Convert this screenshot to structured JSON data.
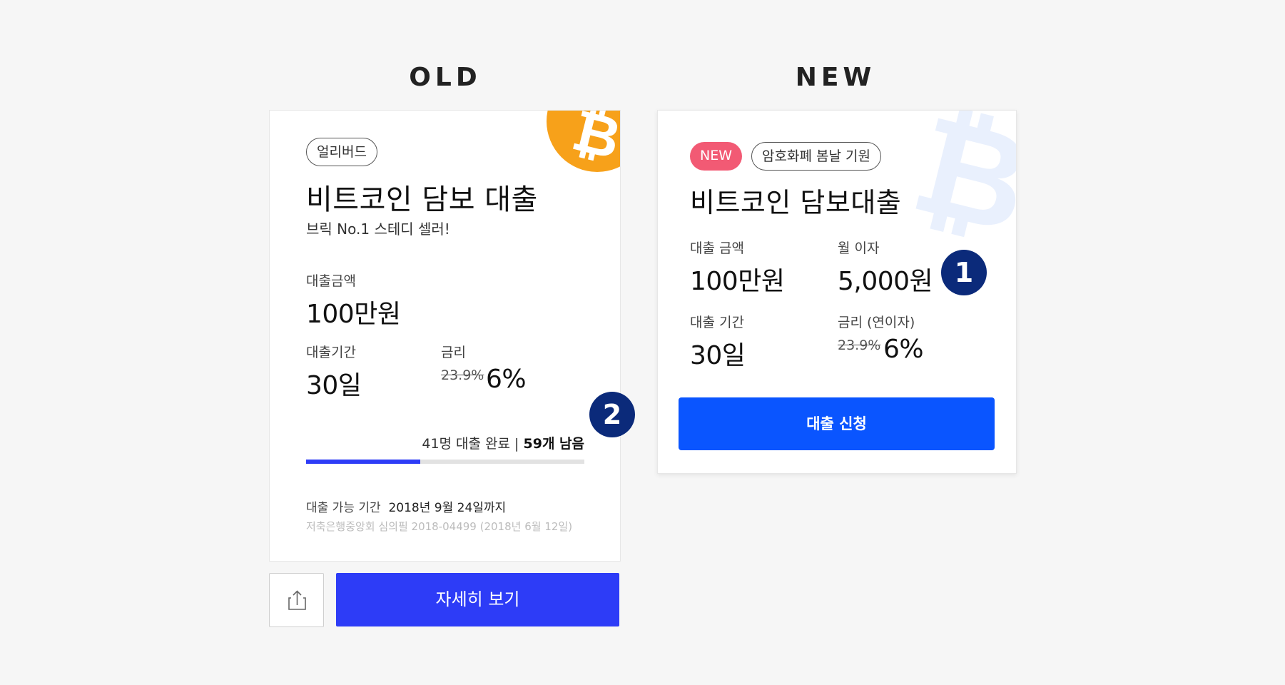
{
  "headings": {
    "old": "OLD",
    "new": "NEW"
  },
  "old_card": {
    "tag": "얼리버드",
    "title": "비트코인 담보 대출",
    "subtitle": "브릭 No.1 스테디 셀러!",
    "amount_label": "대출금액",
    "amount_value": "100만원",
    "period_label": "대출기간",
    "period_value": "30일",
    "rate_label": "금리",
    "rate_old": "23.9%",
    "rate_new": "6%",
    "progress_text": "41명 대출 완료 | ",
    "progress_remaining": "59개 남음",
    "progress_fraction": 0.41,
    "availability_label": "대출 가능 기간",
    "availability_value": "2018년 9월 24일까지",
    "review_note": "저축은행중앙회 심의필 2018-04499 (2018년 6월 12일)",
    "share_icon": "share-icon",
    "detail_button": "자세히 보기",
    "logo_symbol": "₿"
  },
  "new_card": {
    "badge_new": "NEW",
    "tag": "암호화폐 봄날 기원",
    "title": "비트코인 담보대출",
    "amount_label": "대출 금액",
    "amount_value": "100만원",
    "monthly_interest_label": "월 이자",
    "monthly_interest_value": "5,000원",
    "period_label": "대출 기간",
    "period_value": "30일",
    "rate_label": "금리 (연이자)",
    "rate_old": "23.9%",
    "rate_new": "6%",
    "apply_button": "대출 신청",
    "logo_symbol": "₿"
  },
  "markers": {
    "one": "1",
    "two": "2"
  },
  "colors": {
    "primary_blue": "#2d3cf7",
    "apply_blue": "#0a55ff",
    "bitcoin_orange": "#f7a11a",
    "badge_red": "#f25a74",
    "marker_navy": "#0b2a7a"
  }
}
